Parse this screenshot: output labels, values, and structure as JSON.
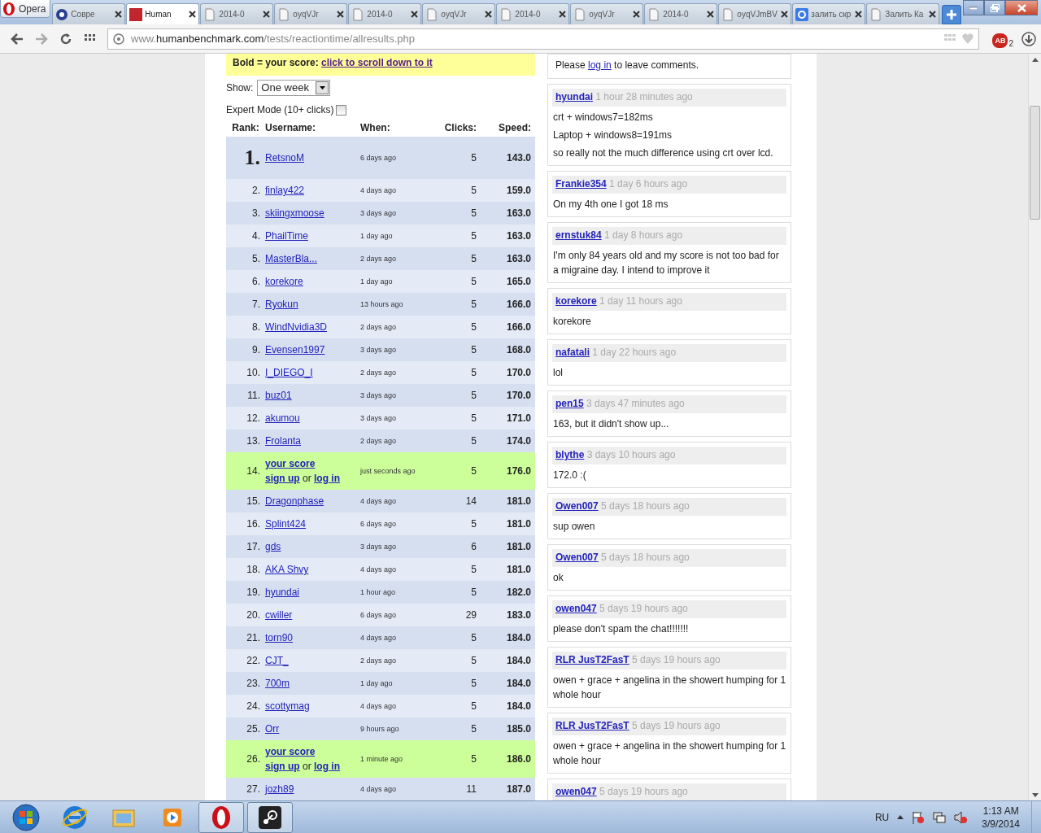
{
  "browser": {
    "menu_label": "Opera",
    "tabs": [
      {
        "label": "Совре",
        "selected": false
      },
      {
        "label": "Human",
        "selected": true
      },
      {
        "label": "2014-0",
        "selected": false
      },
      {
        "label": "oyqVJr",
        "selected": false
      },
      {
        "label": "2014-0",
        "selected": false
      },
      {
        "label": "oyqVJr",
        "selected": false
      },
      {
        "label": "2014-0",
        "selected": false
      },
      {
        "label": "oyqVJr",
        "selected": false
      },
      {
        "label": "2014-0",
        "selected": false
      },
      {
        "label": "oyqVJmBV",
        "selected": false
      },
      {
        "label": "залить скр",
        "selected": false
      },
      {
        "label": "Залить Ка",
        "selected": false
      }
    ],
    "address": {
      "prefix": "www.",
      "host": "humanbenchmark.com",
      "path": "/tests/reactiontime/allresults.php"
    },
    "extension_label": "AB",
    "extension_badge": "2"
  },
  "scores": {
    "notice": {
      "text": "Bold = your score:",
      "link": "click to scroll down to it"
    },
    "show": {
      "label": "Show:",
      "value": "One week"
    },
    "expert": {
      "label": "Expert Mode (10+ clicks)",
      "checked": false
    },
    "columns": [
      "Rank:",
      "Username:",
      "When:",
      "Clicks:",
      "Speed:"
    ],
    "rows": [
      {
        "kind": "top",
        "rank": "1.",
        "user": "RetsnoM",
        "when": "6 days ago",
        "clicks": "5",
        "speed": "143.0"
      },
      {
        "kind": "normal",
        "rank": "2.",
        "user": "finlay422",
        "when": "4 days ago",
        "clicks": "5",
        "speed": "159.0"
      },
      {
        "kind": "normal",
        "rank": "3.",
        "user": "skiingxmoose",
        "when": "3 days ago",
        "clicks": "5",
        "speed": "163.0"
      },
      {
        "kind": "normal",
        "rank": "4.",
        "user": "PhailTime",
        "when": "1 day ago",
        "clicks": "5",
        "speed": "163.0"
      },
      {
        "kind": "normal",
        "rank": "5.",
        "user": "MasterBla...",
        "when": "2 days ago",
        "clicks": "5",
        "speed": "163.0"
      },
      {
        "kind": "normal",
        "rank": "6.",
        "user": "korekore",
        "when": "1 day ago",
        "clicks": "5",
        "speed": "165.0"
      },
      {
        "kind": "normal",
        "rank": "7.",
        "user": "Ryokun",
        "when": "13 hours ago",
        "clicks": "5",
        "speed": "166.0"
      },
      {
        "kind": "normal",
        "rank": "8.",
        "user": "WindNvidia3D",
        "when": "2 days ago",
        "clicks": "5",
        "speed": "166.0"
      },
      {
        "kind": "normal",
        "rank": "9.",
        "user": "Evensen1997",
        "when": "3 days ago",
        "clicks": "5",
        "speed": "168.0"
      },
      {
        "kind": "normal",
        "rank": "10.",
        "user": "I_DIEGO_I",
        "when": "2 days ago",
        "clicks": "5",
        "speed": "170.0"
      },
      {
        "kind": "normal",
        "rank": "11.",
        "user": "buz01",
        "when": "3 days ago",
        "clicks": "5",
        "speed": "170.0"
      },
      {
        "kind": "normal",
        "rank": "12.",
        "user": "akumou",
        "when": "3 days ago",
        "clicks": "5",
        "speed": "171.0"
      },
      {
        "kind": "normal",
        "rank": "13.",
        "user": "Frolanta",
        "when": "2 days ago",
        "clicks": "5",
        "speed": "174.0"
      },
      {
        "kind": "you",
        "rank": "14.",
        "user": "your score",
        "signup": "sign up",
        "or": "or",
        "login": "log in",
        "when": "just seconds ago",
        "clicks": "5",
        "speed": "176.0"
      },
      {
        "kind": "normal",
        "rank": "15.",
        "user": "Dragonphase",
        "when": "4 days ago",
        "clicks": "14",
        "speed": "181.0"
      },
      {
        "kind": "normal",
        "rank": "16.",
        "user": "Splint424",
        "when": "6 days ago",
        "clicks": "5",
        "speed": "181.0"
      },
      {
        "kind": "normal",
        "rank": "17.",
        "user": "gds",
        "when": "3 days ago",
        "clicks": "6",
        "speed": "181.0"
      },
      {
        "kind": "normal",
        "rank": "18.",
        "user": "AKA Shvy",
        "when": "4 days ago",
        "clicks": "5",
        "speed": "181.0"
      },
      {
        "kind": "normal",
        "rank": "19.",
        "user": "hyundai",
        "when": "1 hour ago",
        "clicks": "5",
        "speed": "182.0"
      },
      {
        "kind": "normal",
        "rank": "20.",
        "user": "cwiller",
        "when": "6 days ago",
        "clicks": "29",
        "speed": "183.0"
      },
      {
        "kind": "normal",
        "rank": "21.",
        "user": "torn90",
        "when": "4 days ago",
        "clicks": "5",
        "speed": "184.0"
      },
      {
        "kind": "normal",
        "rank": "22.",
        "user": "CJT_",
        "when": "2 days ago",
        "clicks": "5",
        "speed": "184.0"
      },
      {
        "kind": "normal",
        "rank": "23.",
        "user": "700m",
        "when": "1 day ago",
        "clicks": "5",
        "speed": "184.0"
      },
      {
        "kind": "normal",
        "rank": "24.",
        "user": "scottymag",
        "when": "4 days ago",
        "clicks": "5",
        "speed": "184.0"
      },
      {
        "kind": "normal",
        "rank": "25.",
        "user": "Orr",
        "when": "9 hours ago",
        "clicks": "5",
        "speed": "185.0"
      },
      {
        "kind": "you",
        "rank": "26.",
        "user": "your score",
        "signup": "sign up",
        "or": "or",
        "login": "log in",
        "when": "1 minute ago",
        "clicks": "5",
        "speed": "186.0"
      },
      {
        "kind": "normal",
        "rank": "27.",
        "user": "jozh89",
        "when": "4 days ago",
        "clicks": "11",
        "speed": "187.0"
      }
    ]
  },
  "comments": {
    "login_prompt": {
      "before": "Please",
      "link": "log in",
      "after": "to leave comments."
    },
    "items": [
      {
        "author": "hyundai",
        "time": "1 hour 28 minutes ago",
        "lines": [
          "crt + windows7=182ms",
          "Laptop + windows8=191ms",
          "so really not the much difference using crt over lcd."
        ]
      },
      {
        "author": "Frankie354",
        "time": "1 day 6 hours ago",
        "lines": [
          "On my 4th one I got 18 ms"
        ]
      },
      {
        "author": "ernstuk84",
        "time": "1 day 8 hours ago",
        "lines": [
          "I'm only 84 years old and my score is not too bad for a migraine day. I intend to improve it"
        ]
      },
      {
        "author": "korekore",
        "time": "1 day 11 hours ago",
        "lines": [
          "korekore"
        ]
      },
      {
        "author": "nafatali",
        "time": "1 day 22 hours ago",
        "lines": [
          "lol"
        ]
      },
      {
        "author": "pen15",
        "time": "3 days 47 minutes ago",
        "lines": [
          "163, but it didn't show up..."
        ]
      },
      {
        "author": "blythe",
        "time": "3 days 10 hours ago",
        "lines": [
          "172.0 :("
        ]
      },
      {
        "author": "Owen007",
        "time": "5 days 18 hours ago",
        "lines": [
          "sup owen"
        ]
      },
      {
        "author": "Owen007",
        "time": "5 days 18 hours ago",
        "lines": [
          "ok"
        ]
      },
      {
        "author": "owen047",
        "time": "5 days 19 hours ago",
        "lines": [
          "please don't spam the chat!!!!!!!"
        ]
      },
      {
        "author": "RLR JusT2FasT",
        "time": "5 days 19 hours ago",
        "lines": [
          "owen + grace + angelina in the showert humping for 1 whole hour"
        ]
      },
      {
        "author": "RLR JusT2FasT",
        "time": "5 days 19 hours ago",
        "lines": [
          "owen + grace + angelina in the showert humping for 1 whole hour"
        ]
      },
      {
        "author": "owen047",
        "time": "5 days 19 hours ago"
      }
    ]
  },
  "taskbar": {
    "language": "RU",
    "time": "1:13 AM",
    "date": "3/9/2014"
  }
}
